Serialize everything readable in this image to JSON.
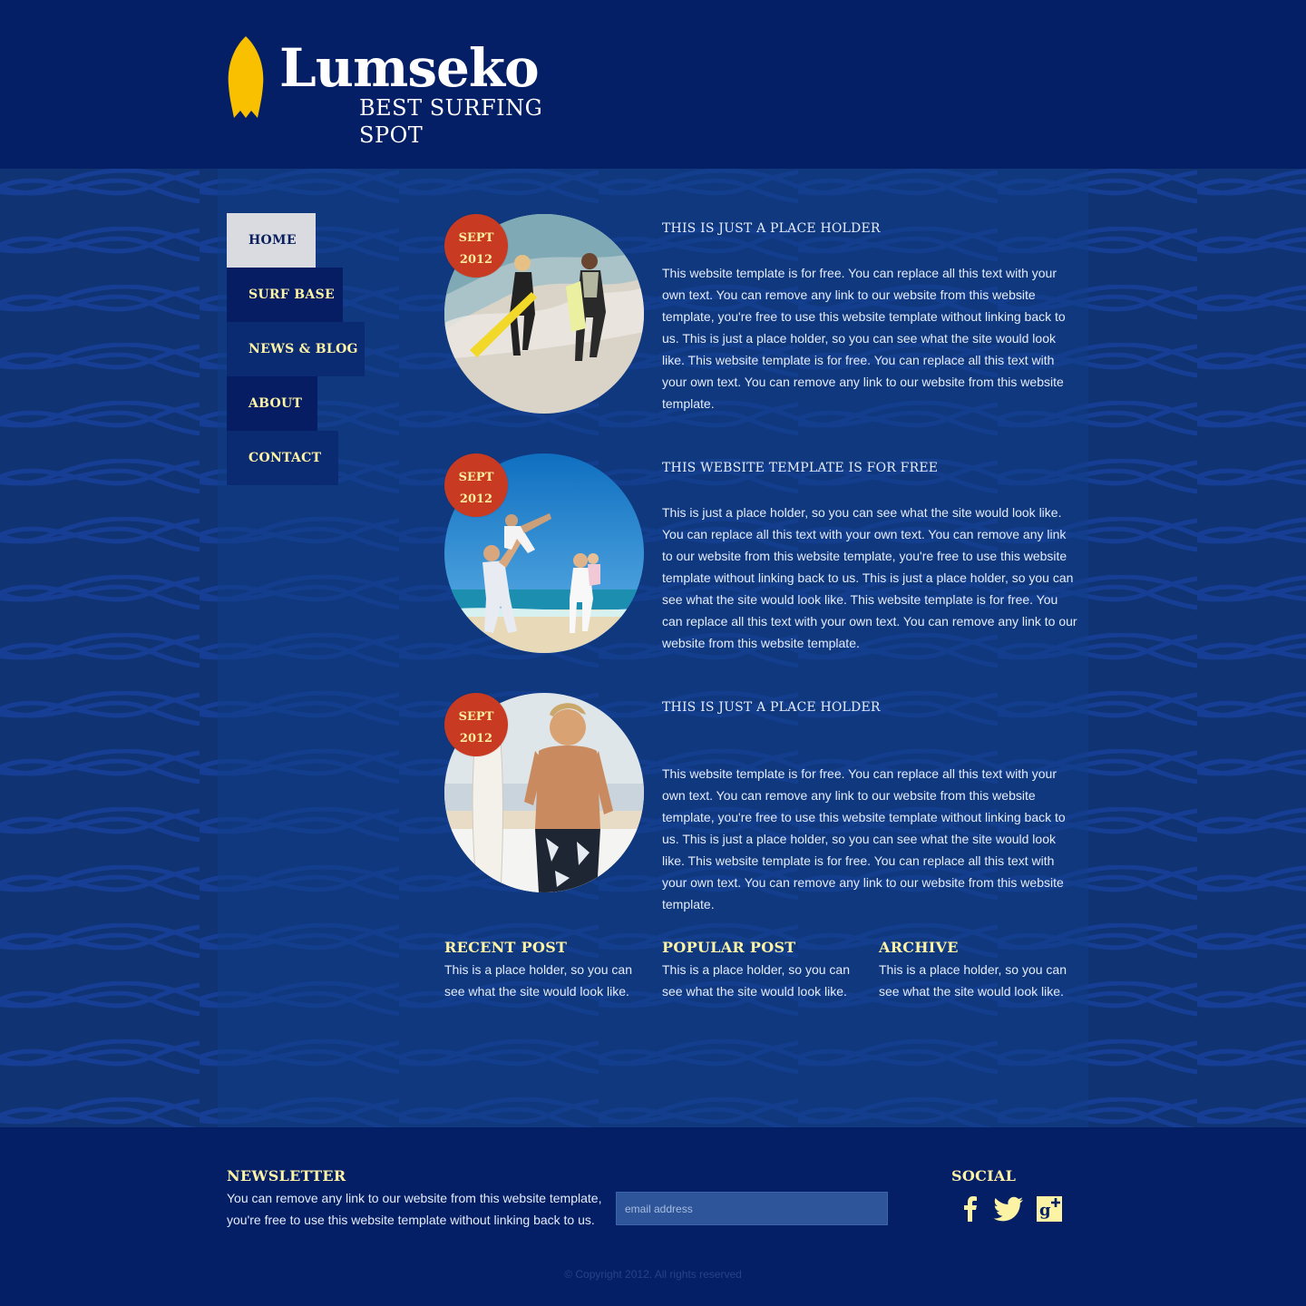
{
  "header": {
    "title": "Lumseko",
    "tagline": "BEST SURFING  SPOT"
  },
  "nav": {
    "items": [
      {
        "label": "HOME",
        "active": true
      },
      {
        "label": "SURF BASE",
        "active": false
      },
      {
        "label": "NEWS & BLOG",
        "active": false
      },
      {
        "label": "ABOUT",
        "active": false
      },
      {
        "label": "CONTACT",
        "active": false
      }
    ]
  },
  "posts": [
    {
      "month": "SEPT",
      "year": "2012",
      "title": "THIS IS JUST A PLACE HOLDER",
      "body": "This website template is for free. You can replace all this text with your own text. You can remove any link to our website from this website template, you're free to use this website template without linking back to us. This is just a place holder, so you can see what the site would look like. This website template is for free. You can replace all this text with your own text. You can remove any link to our website from this website template.",
      "image": "couple-running-with-surfboards"
    },
    {
      "month": "SEPT",
      "year": "2012",
      "title": "THIS WEBSITE TEMPLATE IS FOR FREE",
      "body": "This is just a place holder, so you can see what the site would look like. You can replace all this text with your own text. You can remove any link to our website from this website template, you're free to use this website template without linking back to us. This is just a place holder, so you can see what the site would look like. This website template is for free. You can replace all this text with your own text. You can remove any link to our website from this website template.",
      "image": "family-playing-on-beach"
    },
    {
      "month": "SEPT",
      "year": "2012",
      "title": "THIS IS JUST A PLACE HOLDER",
      "body": "This website template is for free. You can replace all this text with your own text. You can remove any link to our website from this website template, you're free to use this website template without linking back to us. This is just a place holder, so you can see what the site would look like. This website template is for free. You can replace all this text with your own text. You can remove any link to our website from this website template.",
      "image": "man-with-surfboard"
    }
  ],
  "widgets": [
    {
      "title": "RECENT POST",
      "text": "This is a place holder, so you can see what the site would look like."
    },
    {
      "title": "POPULAR POST",
      "text": "This is a place holder, so you can see what the site would look like."
    },
    {
      "title": "ARCHIVE",
      "text": "This is a place holder, so you can see what the site would look like."
    }
  ],
  "footer": {
    "newsletter": {
      "title": "NEWSLETTER",
      "text": "You can remove any link to our website from this website template, you're free to use this website template without linking back to us.",
      "placeholder": "email address"
    },
    "social": {
      "title": "SOCIAL",
      "icons": [
        "facebook-icon",
        "twitter-icon",
        "google-plus-icon"
      ]
    },
    "copyright": "© Copyright 2012. All rights reserved"
  },
  "colors": {
    "header_bg": "#041f66",
    "body_bg": "#0f3373",
    "accent_yellow": "#fdf3a4",
    "badge_red": "#c93a22",
    "logo_board": "#f9c000"
  }
}
